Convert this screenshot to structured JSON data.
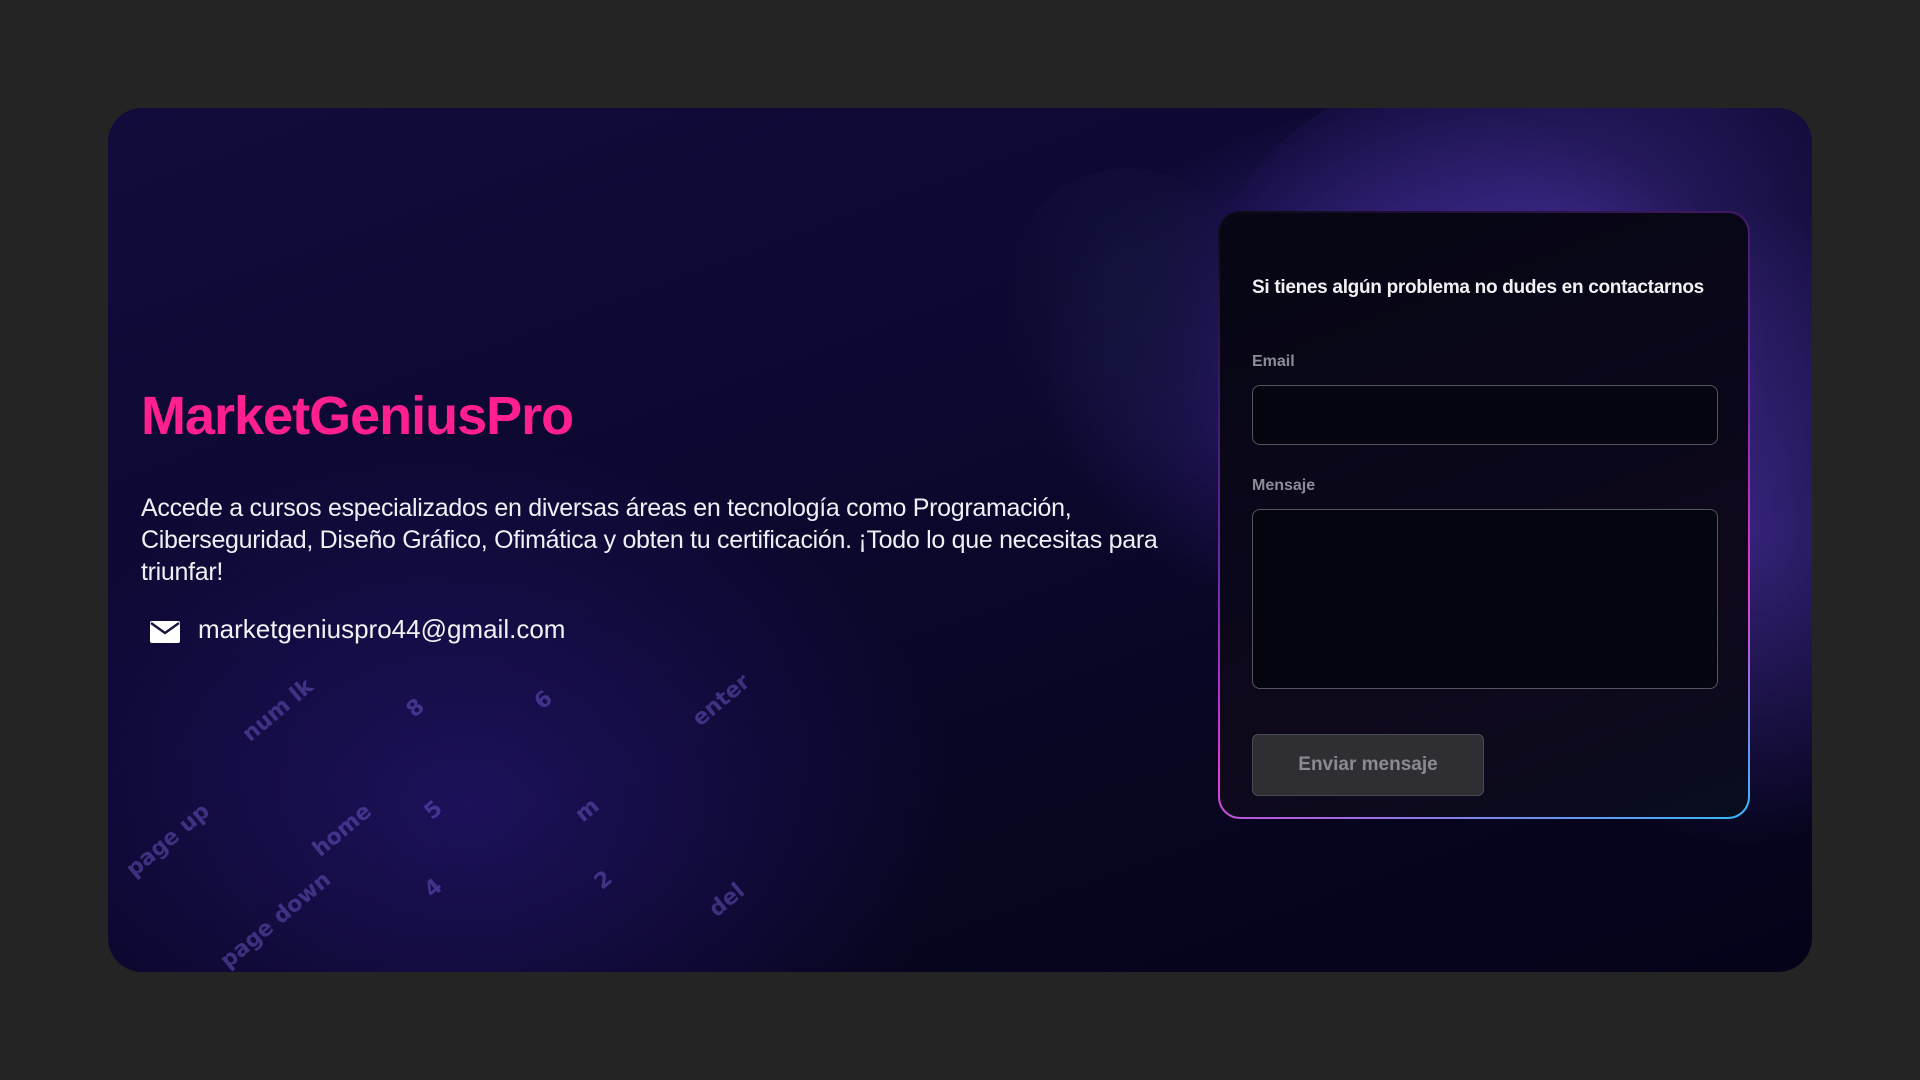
{
  "hero": {
    "brand": "MarketGeniusPro",
    "description": "Accede a cursos especializados en diversas áreas en tecnología como Programación, Ciberseguridad, Diseño Gráfico, Ofimática y obten tu certificación. ¡Todo lo que necesitas para triunfar!",
    "email": "marketgeniuspro44@gmail.com",
    "email_icon": "envelope-icon"
  },
  "contact_form": {
    "title": "Si tienes algún problema no dudes en contactarnos",
    "email_label": "Email",
    "email_value": "",
    "message_label": "Mensaje",
    "message_value": "",
    "submit_label": "Enviar mensaje"
  },
  "background_keys": [
    "num lk",
    "8",
    "6",
    "enter",
    "5",
    "m",
    "page up",
    "home",
    "4",
    "2",
    "page down",
    "del"
  ],
  "colors": {
    "page_background": "#242424",
    "brand": "#ff1f8e",
    "card_dark": "#07051f",
    "form_border_gradient_start": "#6a2aa8",
    "form_border_gradient_mid": "#e23ad0",
    "form_border_gradient_end": "#38b8ff",
    "button_background": "#2f2f33"
  }
}
